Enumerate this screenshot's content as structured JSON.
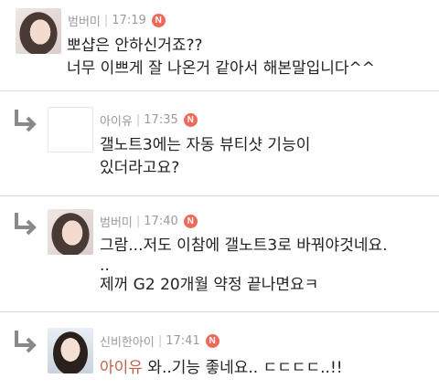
{
  "comments": [
    {
      "author": "범버미",
      "time": "17:19",
      "badge": "N",
      "avatar_icon": "profile-photo",
      "lines": [
        "뽀샵은 안하신거죠??",
        "너무 이쁘게 잘 나온거 같아서 해본말입니다^^"
      ]
    },
    {
      "author": "아이유",
      "time": "17:35",
      "badge": "N",
      "avatar_icon": "empty-profile",
      "reply_icon": "reply-arrow-icon",
      "lines": [
        "갤노트3에는 자동 뷰티샷 기능이",
        "있더라고요?"
      ]
    },
    {
      "author": "범버미",
      "time": "17:40",
      "badge": "N",
      "avatar_icon": "profile-photo",
      "reply_icon": "reply-arrow-icon",
      "lines": [
        "그람...저도 이참에 갤노트3로 바꿔야것네요.",
        "..",
        "제꺼 G2 20개월 약정 끝나면요ㅋ"
      ]
    },
    {
      "author": "신비한아이",
      "time": "17:41",
      "badge": "N",
      "avatar_icon": "profile-photo",
      "reply_icon": "reply-arrow-icon",
      "mention": "아이유",
      "text": " 와..기능 좋네요.. ㄷㄷㄷㄷ..!!"
    }
  ],
  "colors": {
    "badge": "#ef6a5a",
    "mention": "#c0624d",
    "meta": "#9a9a9a",
    "separator": "#d9d9d9"
  }
}
